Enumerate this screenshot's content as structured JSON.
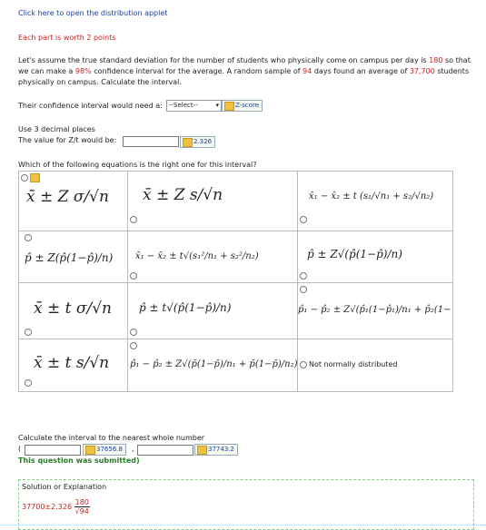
{
  "applet_link": "Click here to open the distribution applet",
  "worth": "Each part is worth 2 points",
  "problem": {
    "p1": "Let's assume the true standard deviation for the number of students who physically come on campus per day is ",
    "sd": "180",
    "p2": " so that we can make a ",
    "conf": "98%",
    "p3": " confidence interval for the average. A random sample of ",
    "n": "94",
    "p4": " days found an average of ",
    "mean": "37,700",
    "p5": " students physically on campus. Calculate the interval."
  },
  "q1": {
    "label": "Their confidence interval would need a:",
    "select_value": "--Select--",
    "answer": "Z-score"
  },
  "q2": {
    "decimals": "Use 3 decimal places",
    "label": "The value for Z/t would be:",
    "answer": "2.326"
  },
  "q3": {
    "label": "Which of the following equations is the right one for this interval?"
  },
  "table": {
    "not_normal": "Not normally distributed"
  },
  "q4": {
    "label": "Calculate the interval to the nearest whole number",
    "open": "(",
    "sep": ",",
    "close": ")",
    "lower": "37656.8",
    "upper": "37743.2",
    "submitted": "This question was submitted"
  },
  "solution": {
    "title": "Solution or Explanation",
    "expr": "37700±2.326",
    "num": "180",
    "den": "√94"
  }
}
